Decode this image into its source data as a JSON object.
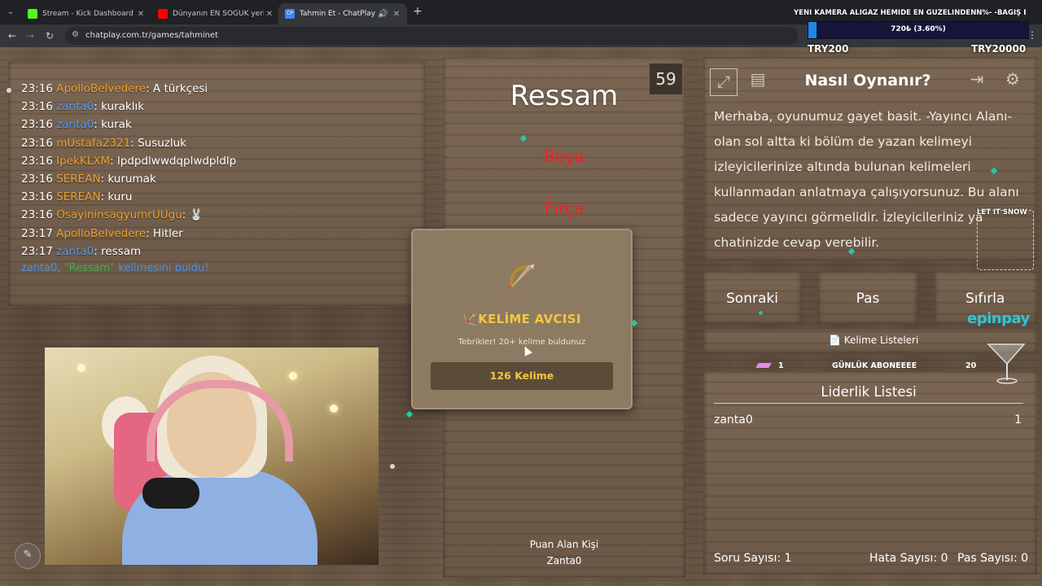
{
  "browser": {
    "tabs": [
      {
        "title": "Stream - Kick Dashboard",
        "color": "#53fc18",
        "active": false
      },
      {
        "title": "Dünyanın EN SOĞUK yerinde B",
        "color": "#ff0000",
        "active": false
      },
      {
        "title": "Tahmin Et - ChatPlay",
        "color": "#4285f4",
        "active": true
      }
    ],
    "url": "chatplay.com.tr/games/tahminet"
  },
  "donation": {
    "title": "YENİ KAMERA ALIGAZ HEMİDE EN GÜZELİNDENN%- -BAĞIŞ BARI",
    "progress_label": "720₺ (3.60%)",
    "progress_fraction": 0.036,
    "min": "TRY200",
    "max": "TRY20000"
  },
  "chat": [
    {
      "time": "23:16",
      "user": "ApolloBelvedere",
      "color": "#f0a030",
      "text": "A türkçesi"
    },
    {
      "time": "23:16",
      "user": "zanta0",
      "color": "#5b9bef",
      "text": "kuraklık"
    },
    {
      "time": "23:16",
      "user": "zanta0",
      "color": "#5b9bef",
      "text": "kurak"
    },
    {
      "time": "23:16",
      "user": "mUstafa2321",
      "color": "#f0a030",
      "text": "Susuzluk"
    },
    {
      "time": "23:16",
      "user": "IpekKLXM",
      "color": "#f0a030",
      "text": "lpdpdlwwdqplwdpldlp"
    },
    {
      "time": "23:16",
      "user": "SEREAN",
      "color": "#f0a030",
      "text": "kurumak"
    },
    {
      "time": "23:16",
      "user": "SEREAN",
      "color": "#f0a030",
      "text": "kuru"
    },
    {
      "time": "23:16",
      "user": "OsayininsagyumrUUgu",
      "color": "#f0a030",
      "text": "🐰"
    },
    {
      "time": "23:17",
      "user": "ApolloBelvedere",
      "color": "#f0a030",
      "text": "Hitler"
    },
    {
      "time": "23:17",
      "user": "zanta0",
      "color": "#5b9bef",
      "text": "ressam"
    }
  ],
  "chat_system": {
    "user": "zanta0,",
    "word": "\"Ressam\"",
    "rest": "kelimesini buldu!"
  },
  "game": {
    "timer": "59",
    "word": "Ressam",
    "taboo": [
      "Boya",
      "Fırça"
    ],
    "scorer_label": "Puan Alan Kişi",
    "scorer_name": "Zanta0"
  },
  "modal": {
    "title": "🏹KELİME AVCISI",
    "subtitle": "Tebrikler! 20+ kelime buldunuz",
    "button": "126 Kelime"
  },
  "help": {
    "title": "Nasıl Oynanır?",
    "text": "Merhaba, oyunumuz gayet basit. -Yayıncı Alanı- olan sol altta ki bölüm de yazan kelimeyi izleyicilerinize altında bulunan kelimeleri kullanmadan anlatmaya çalışıyorsunuz. Bu alanı sadece yayıncı görmelidir. İzleyicileriniz ya chatinizde cevap verebilir."
  },
  "controls": {
    "next": "Sonraki",
    "pass": "Pas",
    "reset": "Sıfırla"
  },
  "word_lists": {
    "label": "📄 Kelime Listeleri",
    "rank": "1",
    "name": "GÜNLÜK ABONEEEE",
    "count": "20"
  },
  "leaderboard": {
    "title": "Liderlik Listesi",
    "rows": [
      {
        "name": "zanta0",
        "score": "1"
      }
    ]
  },
  "stats": {
    "questions": "Soru Sayısı: 1",
    "errors": "Hata Sayısı: 0",
    "passes": "Pas Sayısı: 0"
  },
  "overlays": {
    "snow": "LET IT SNOW",
    "sponsor": "epinpay"
  }
}
